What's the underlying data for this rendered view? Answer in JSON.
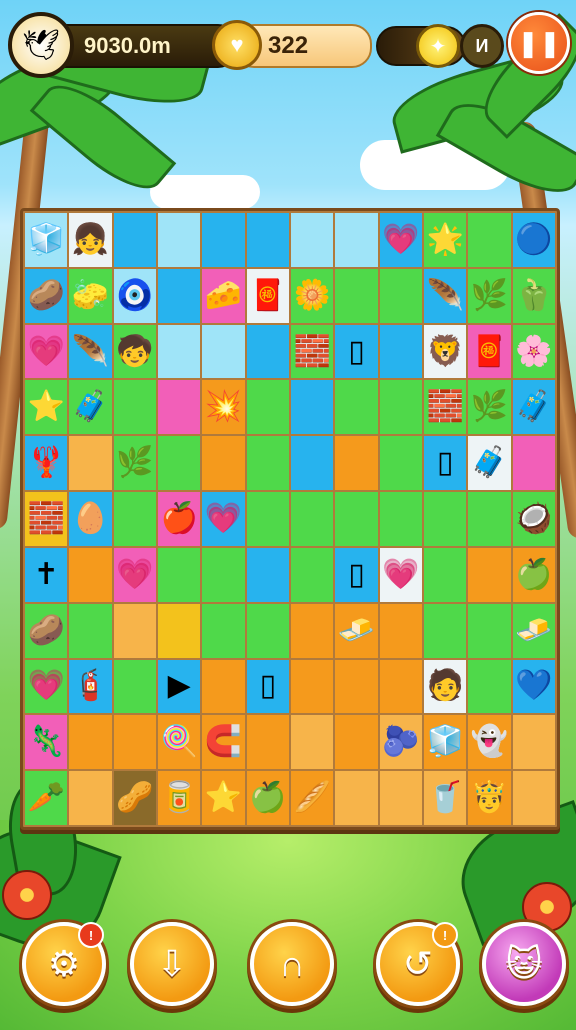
{
  "hud": {
    "distance_text": "9030.0m",
    "coins_text": "322",
    "small_badge_text": "И",
    "pause_icon": "pause-icon",
    "colors": {
      "accent": "#f07a1c",
      "coin": "#f5b81c"
    }
  },
  "board": {
    "columns": 12,
    "rows": 11,
    "cells": [
      [
        "lb:🧊",
        "w:👧",
        "b:",
        "lb:",
        "b:",
        "b:",
        "lb:",
        "lb:",
        "b:💗",
        "g:🌟",
        "g:",
        "b:🔵"
      ],
      [
        "b:🥔",
        "g:🧽",
        "lb:🧿",
        "b:",
        "p:🧀",
        "w:🧧",
        "g:🌼",
        "g:",
        "g:",
        "b:🪶",
        "g:🌿",
        "g:🫑"
      ],
      [
        "p:💗",
        "b:🪶",
        "g:🧒",
        "lb:",
        "lb:",
        "b:",
        "g:🧱",
        "b:▯",
        "b:",
        "w:🦁",
        "p:🧧",
        "g:🌸"
      ],
      [
        "g:⭐",
        "g:🧳",
        "g:",
        "p:",
        "o:💥",
        "g:",
        "b:",
        "g:",
        "g:",
        "g:🧱",
        "g:🌿",
        "b:🧳"
      ],
      [
        "b:🦞",
        "lo:",
        "g:🌿",
        "g:",
        "o:",
        "g:",
        "b:",
        "o:",
        "g:",
        "b:▯",
        "w:🧳",
        "p:"
      ],
      [
        "y:🧱",
        "b:🥚",
        "g:",
        "p:🍎",
        "b:💗",
        "g:",
        "g:",
        "g:",
        "g:",
        "g:",
        "g:",
        "g:🥥"
      ],
      [
        "b:✝",
        "o:",
        "p:💗",
        "g:",
        "g:",
        "b:",
        "g:",
        "b:▯",
        "w:💗",
        "g:",
        "o:",
        "o:🍏"
      ],
      [
        "g:🥔",
        "g:",
        "lo:",
        "y:",
        "g:",
        "g:",
        "o:",
        "o:🧈",
        "o:",
        "g:",
        "g:",
        "g:🧈"
      ],
      [
        "g:💗",
        "b:🧯",
        "g:",
        "b:▶",
        "o:",
        "b:▯",
        "o:",
        "o:",
        "o:",
        "w:🧑",
        "g:",
        "b:💙"
      ],
      [
        "p:🦎",
        "o:",
        "o:",
        "o:🍭",
        "o:🧲",
        "o:",
        "lo:",
        "o:",
        "lo:🫐",
        "o:🧊",
        "o:👻",
        "lo:"
      ],
      [
        "g:🥕",
        "lo:",
        "d:🥜",
        "o:🥫",
        "o:⭐",
        "o:🍏",
        "o:🥖",
        "lo:",
        "lo:",
        "lo:🥤",
        "o:🤴",
        "lo:"
      ]
    ]
  },
  "buttons": [
    {
      "name": "settings-button",
      "icon": "gear-icon",
      "glyph": "⚙",
      "badge": "!"
    },
    {
      "name": "download-button",
      "icon": "arrow-down-icon",
      "glyph": "⇩",
      "badge": ""
    },
    {
      "name": "magnet-button",
      "icon": "magnet-icon",
      "glyph": "∩",
      "badge": ""
    },
    {
      "name": "swap-button",
      "icon": "swap-icon",
      "glyph": "↺",
      "badge": "!"
    },
    {
      "name": "character-button",
      "icon": "character-icon",
      "glyph": "😺",
      "badge": ""
    }
  ]
}
